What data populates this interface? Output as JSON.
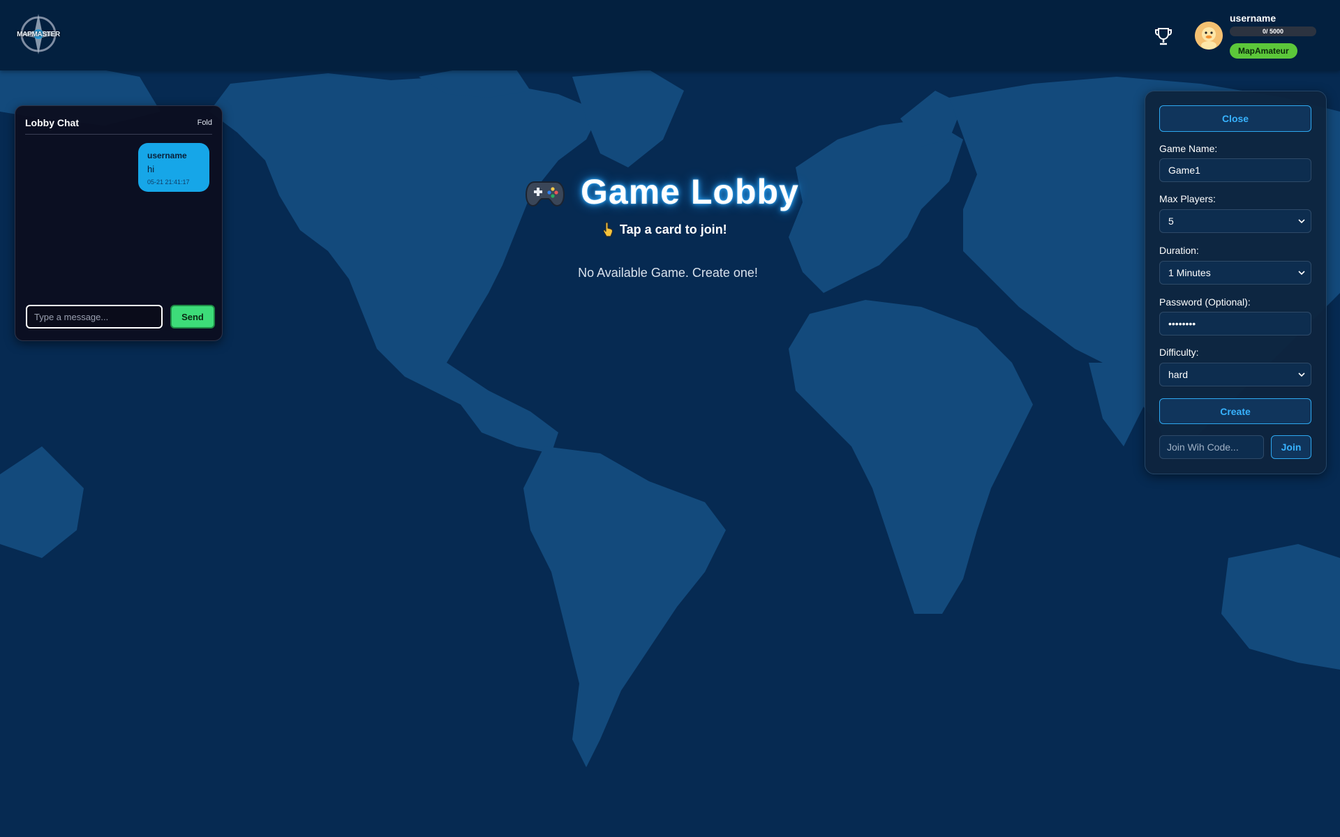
{
  "header": {
    "logo_text": "MAPMASTER",
    "username": "username",
    "xp_text": "0/ 5000",
    "xp_progress": 0,
    "rank": "MapAmateur"
  },
  "chat": {
    "title": "Lobby Chat",
    "fold_label": "Fold",
    "messages": [
      {
        "user": "username",
        "text": "hi",
        "time": "05-21 21:41:17"
      }
    ],
    "input_placeholder": "Type a message...",
    "send_label": "Send"
  },
  "main": {
    "title": "Game Lobby",
    "subtitle": "Tap a card to join!",
    "empty_text": "No Available Game. Create one!"
  },
  "create_panel": {
    "close_label": "Close",
    "game_name_label": "Game Name:",
    "game_name_value": "Game1",
    "max_players_label": "Max Players:",
    "max_players_value": "5",
    "duration_label": "Duration:",
    "duration_value": "1 Minutes",
    "password_label": "Password (Optional):",
    "password_value": "••••••••",
    "difficulty_label": "Difficulty:",
    "difficulty_value": "hard",
    "create_label": "Create",
    "join_code_placeholder": "Join Wih Code...",
    "join_label": "Join"
  },
  "colors": {
    "background": "#062a52",
    "header": "#03203f",
    "accent": "#37b2ff",
    "chat_bubble": "#16a6e8",
    "send_button": "#3ddc79",
    "rank_badge": "#5cc73a"
  },
  "icons": {
    "trophy": "trophy-icon",
    "gamepad": "gamepad-icon",
    "pointer": "pointing-hand-icon",
    "avatar": "duck-avatar"
  }
}
